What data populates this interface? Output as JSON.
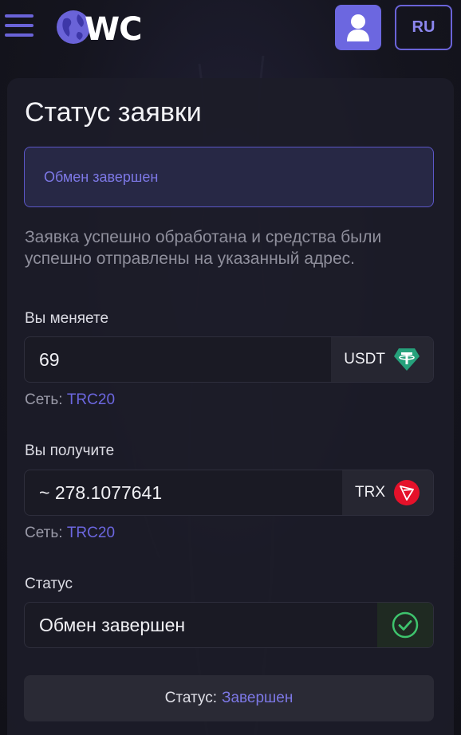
{
  "header": {
    "logo_text": "WC",
    "user_icon": "user-icon",
    "language": "RU"
  },
  "card": {
    "title": "Статус заявки",
    "status_message": "Обмен завершен",
    "description": "Заявка успешно обработана и средства были успешно отправлены на указанный адрес."
  },
  "send": {
    "label": "Вы меняете",
    "amount": "69",
    "currency": "USDT",
    "currency_icon": "tether-icon",
    "network_label": "Сеть:",
    "network": "TRC20"
  },
  "receive": {
    "label": "Вы получите",
    "amount": "~ 278.1077641",
    "currency": "TRX",
    "currency_icon": "tron-icon",
    "network_label": "Сеть:",
    "network": "TRC20"
  },
  "status": {
    "label": "Статус",
    "value": "Обмен завершен",
    "icon": "check-circle-icon"
  },
  "footer": {
    "label": "Статус:",
    "value": "Завершен"
  },
  "colors": {
    "accent": "#6c67e0",
    "success": "#3ec46d",
    "tether": "#26a17b",
    "tron": "#e5112a"
  }
}
